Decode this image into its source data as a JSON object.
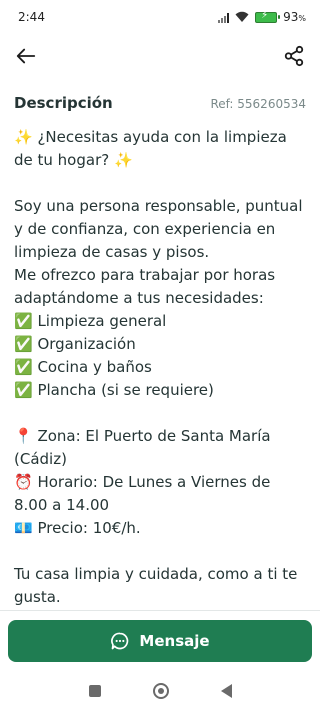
{
  "status": {
    "time": "2:44",
    "battery": "93",
    "battery_unit": "%"
  },
  "appbar": {
    "back_icon": "arrow-left-icon",
    "share_icon": "share-icon"
  },
  "listing": {
    "section_title": "Descripción",
    "ref": "Ref: 556260534",
    "description": "✨ ¿Necesitas ayuda con la limpieza de tu hogar? ✨\n\nSoy una persona responsable, puntual y de confianza, con experiencia en limpieza de casas y pisos.\nMe ofrezco para trabajar por horas adaptándome a tus necesidades:\n✅ Limpieza general\n✅ Organización\n✅ Cocina y baños\n✅ Plancha (si se requiere)\n\n📍 Zona: El Puerto de Santa María (Cádiz)\n⏰ Horario: De Lunes a Viernes de 8.00 a 14.00\n💶 Precio: 10€/h.\n\nTu casa limpia y cuidada, como a ti te gusta."
  },
  "cta": {
    "label": "Mensaje",
    "icon": "chat-bubble-icon",
    "color": "#1f7d52"
  },
  "nav": {
    "recents_icon": "square-icon",
    "home_icon": "home-circle-icon",
    "back_icon": "back-triangle-icon"
  }
}
